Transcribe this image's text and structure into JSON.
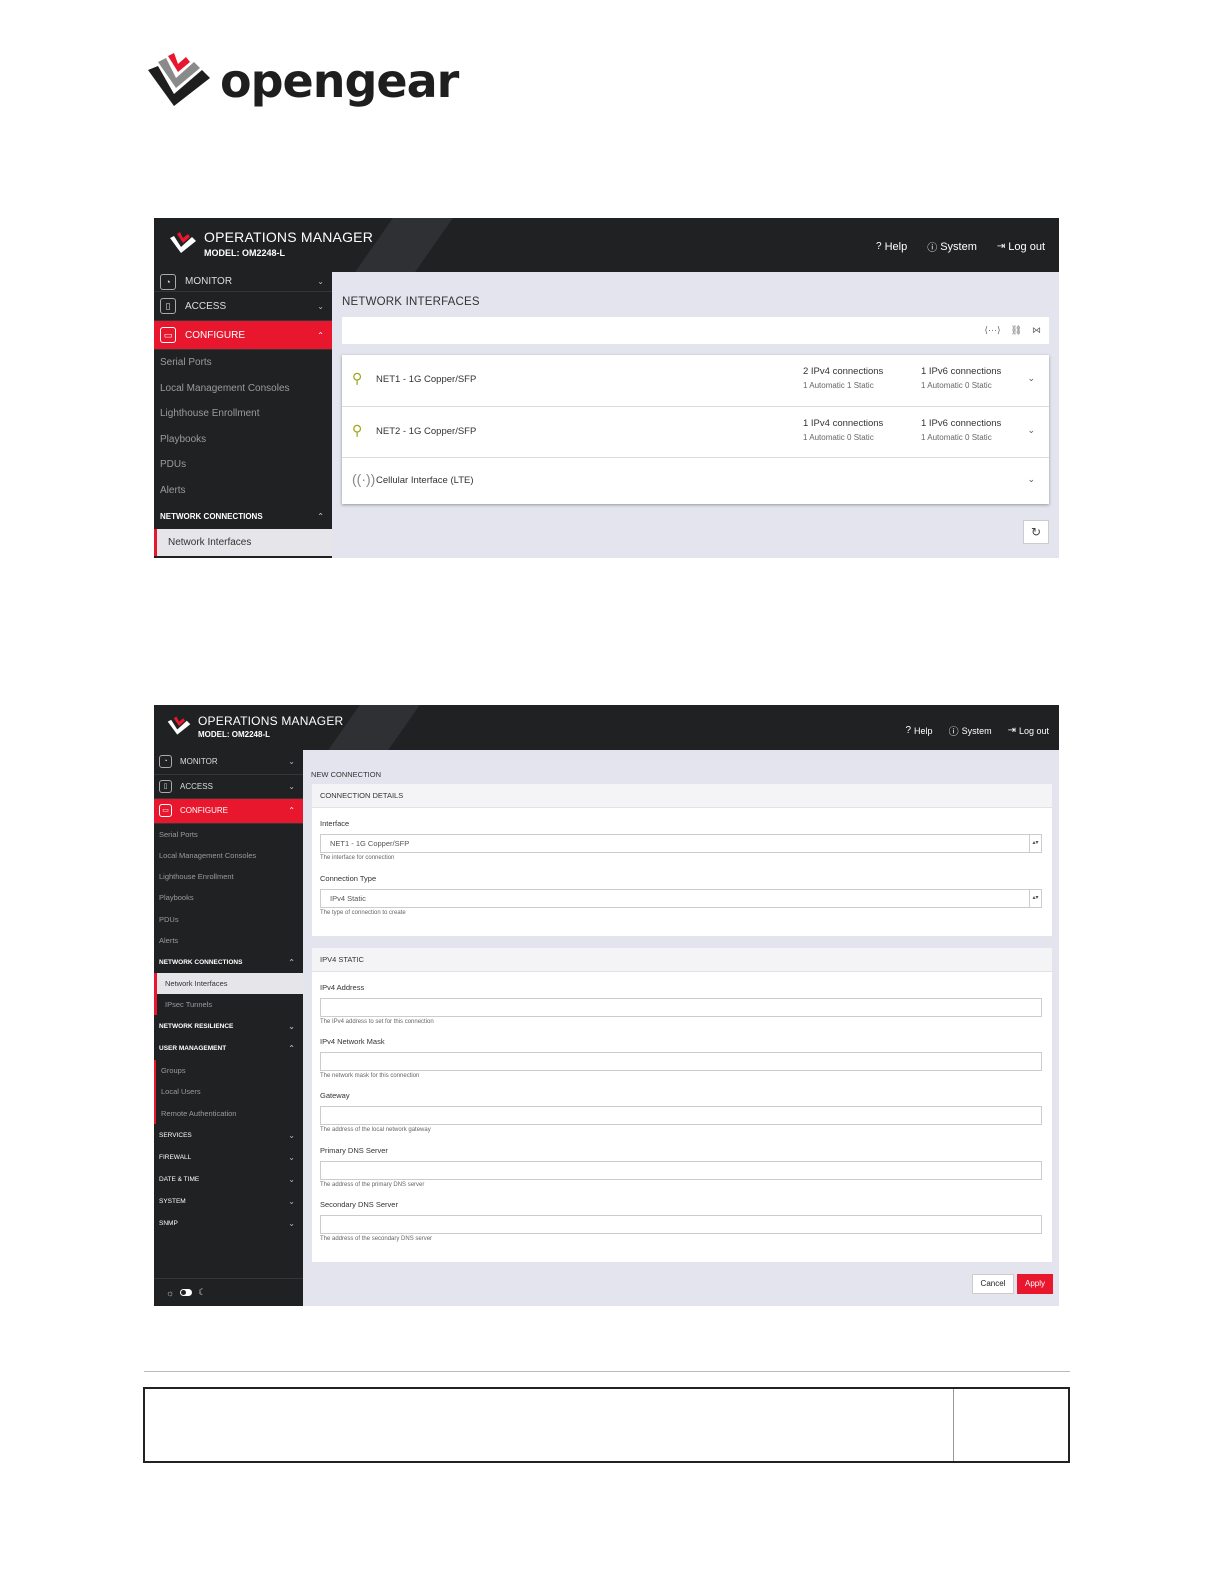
{
  "logo": {
    "text": "opengear"
  },
  "screen1": {
    "header": {
      "title": "OPERATIONS MANAGER",
      "model": "MODEL: OM2248-L",
      "links": [
        {
          "icon": "help-icon",
          "label": "Help"
        },
        {
          "icon": "system-icon",
          "label": "System"
        },
        {
          "icon": "logout-icon",
          "label": "Log out"
        }
      ]
    },
    "sidebar": {
      "monitor": "MONITOR",
      "access": "ACCESS",
      "configure": "CONFIGURE",
      "configure_items": [
        "Serial Ports",
        "Local Management Consoles",
        "Lighthouse Enrollment",
        "Playbooks",
        "PDUs",
        "Alerts"
      ],
      "network_connections": "NETWORK CONNECTIONS",
      "network_interfaces": "Network Interfaces"
    },
    "page_title": "NETWORK INTERFACES",
    "interfaces": [
      {
        "name": "NET1 - 1G Copper/SFP",
        "ipv4": "2 IPv4 connections",
        "ipv4_sub": "1 Automatic 1 Static",
        "ipv6": "1 IPv6 connections",
        "ipv6_sub": "1 Automatic 0 Static"
      },
      {
        "name": "NET2 - 1G Copper/SFP",
        "ipv4": "1 IPv4 connections",
        "ipv4_sub": "1 Automatic 0 Static",
        "ipv6": "1 IPv6 connections",
        "ipv6_sub": "1 Automatic 0 Static"
      },
      {
        "name": "Cellular Interface (LTE)"
      }
    ]
  },
  "screen2": {
    "header": {
      "title": "OPERATIONS MANAGER",
      "model": "MODEL: OM2248-L",
      "links": [
        {
          "icon": "help-icon",
          "label": "Help"
        },
        {
          "icon": "system-icon",
          "label": "System"
        },
        {
          "icon": "logout-icon",
          "label": "Log out"
        }
      ]
    },
    "sidebar": {
      "monitor": "MONITOR",
      "access": "ACCESS",
      "configure": "CONFIGURE",
      "configure_items": [
        "Serial Ports",
        "Local Management Consoles",
        "Lighthouse Enrollment",
        "Playbooks",
        "PDUs",
        "Alerts"
      ],
      "network_connections": "NETWORK CONNECTIONS",
      "network_interfaces": "Network Interfaces",
      "ipsec_tunnels": "IPsec Tunnels",
      "network_resilience": "NETWORK RESILIENCE",
      "user_management": "USER MANAGEMENT",
      "user_items": [
        "Groups",
        "Local Users",
        "Remote Authentication"
      ],
      "bottom_groups": [
        "SERVICES",
        "FIREWALL",
        "DATE & TIME",
        "SYSTEM",
        "SNMP"
      ]
    },
    "page_title": "NEW CONNECTION",
    "connection_details": {
      "heading": "CONNECTION DETAILS",
      "interface_label": "Interface",
      "interface_value": "NET1 - 1G Copper/SFP",
      "interface_hint": "The interface for connection",
      "type_label": "Connection Type",
      "type_value": "IPv4 Static",
      "type_hint": "The type of connection to create"
    },
    "ipv4_static": {
      "heading": "IPV4 STATIC",
      "fields": [
        {
          "label": "IPv4 Address",
          "hint": "The IPv4 address to set for this connection"
        },
        {
          "label": "IPv4 Network Mask",
          "hint": "The network mask for this connection"
        },
        {
          "label": "Gateway",
          "hint": "The address of the local network gateway"
        },
        {
          "label": "Primary DNS Server",
          "hint": "The address of the primary DNS server"
        },
        {
          "label": "Secondary DNS Server",
          "hint": "The address of the secondary DNS server"
        }
      ]
    },
    "buttons": {
      "cancel": "Cancel",
      "apply": "Apply"
    }
  },
  "colors": {
    "accent": "#e8172e",
    "header_bg": "#1f2123",
    "content_bg": "#e3e4ee"
  }
}
